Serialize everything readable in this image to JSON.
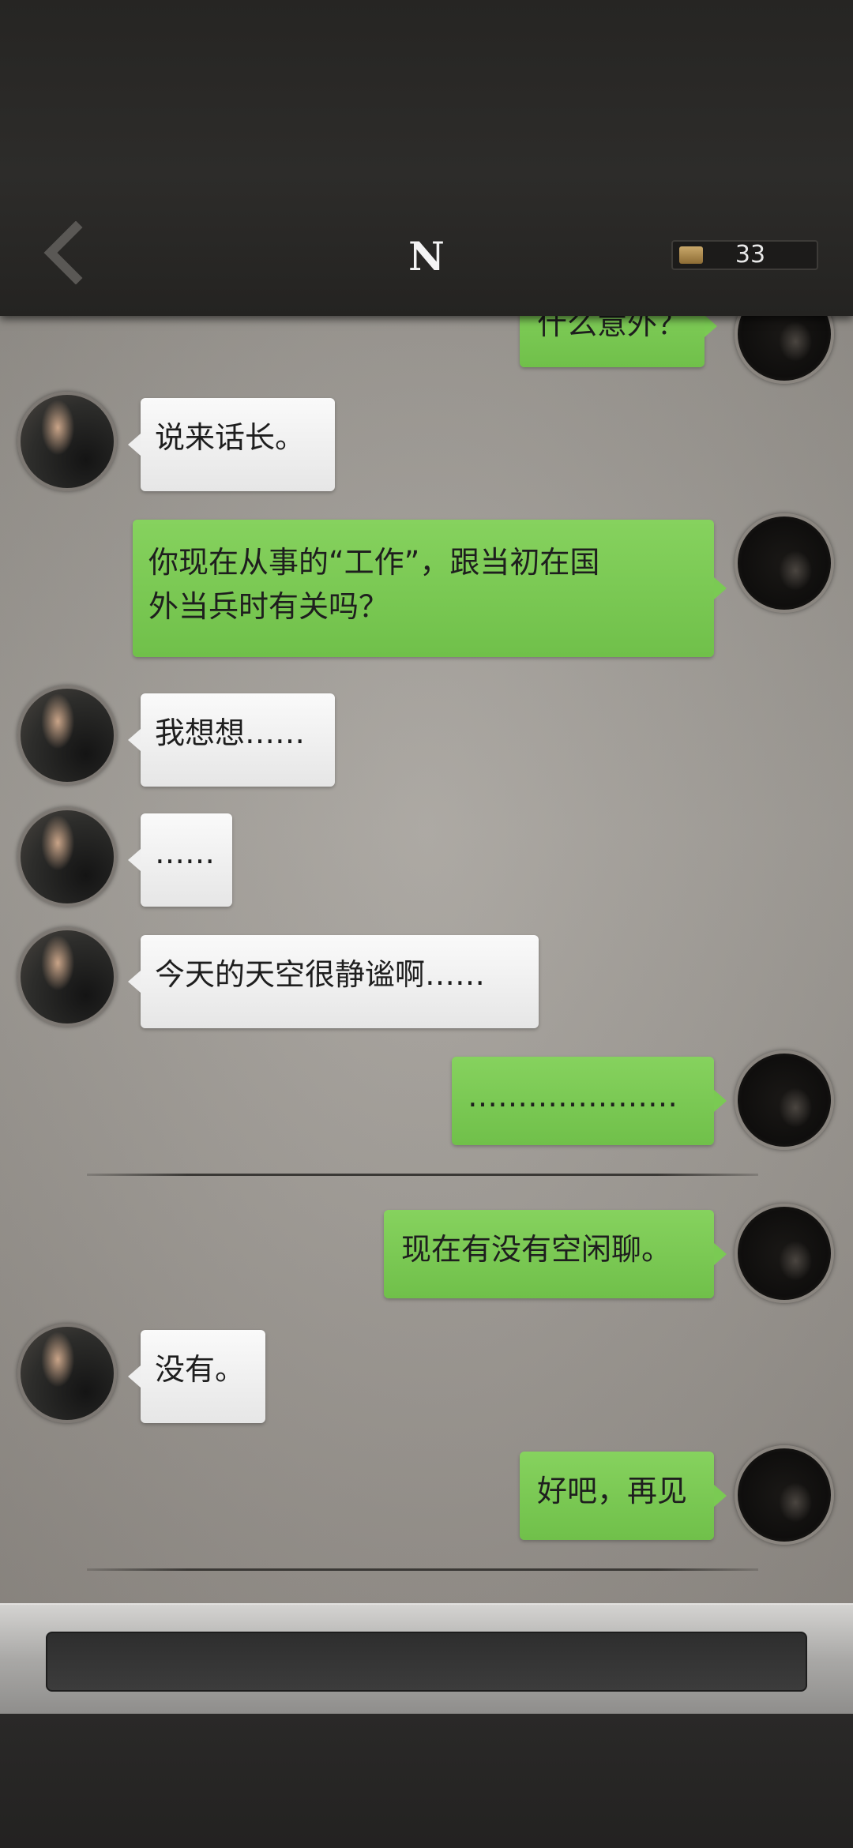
{
  "header": {
    "title": "N",
    "currency_value": "33"
  },
  "messages": [
    {
      "id": "m0",
      "side": "right",
      "text": "什么意外？",
      "partial": true
    },
    {
      "id": "m1",
      "side": "left",
      "text": "说来话长。"
    },
    {
      "id": "m2",
      "side": "right",
      "lines": [
        "你现在从事的“工作”，跟当初在国",
        "外当兵时有关吗？"
      ]
    },
    {
      "id": "m3",
      "side": "left",
      "text": "我想想……"
    },
    {
      "id": "m4",
      "side": "left",
      "text": "……"
    },
    {
      "id": "m5",
      "side": "left",
      "text": "今天的天空很静谧啊……"
    },
    {
      "id": "m6",
      "side": "right",
      "text": "…………………"
    },
    {
      "id": "m7",
      "side": "right",
      "text": "现在有没有空闲聊。"
    },
    {
      "id": "m8",
      "side": "left",
      "text": "没有。"
    },
    {
      "id": "m9",
      "side": "right",
      "text": "好吧，再见"
    }
  ],
  "input": {
    "value": ""
  }
}
